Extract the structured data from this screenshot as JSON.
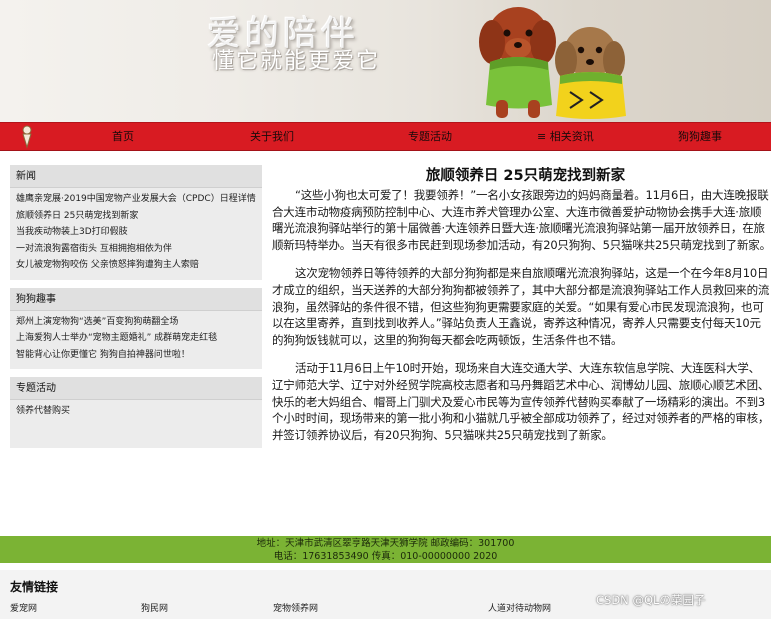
{
  "banner": {
    "title": "爱的陪伴",
    "slogan": "懂它就能更爱它"
  },
  "nav": {
    "items": [
      "首页",
      "关于我们",
      "专题活动",
      "≡ 相关资讯",
      "狗狗趣事"
    ],
    "color": "#d81b22"
  },
  "sidebar": {
    "sections": [
      {
        "title": "新闻",
        "items": [
          "雄鹰亲宠展·2019中国宠物产业发展大会（CPDC）日程详情",
          "旅顺领养日 25只萌宠找到新家",
          "当我疾动物装上3D打印假肢",
          "一对流浪狗露宿街头 互相拥抱相依为伴",
          "女儿被宠物狗咬伤 父亲愤怒摔狗遭狗主人索赔"
        ]
      },
      {
        "title": "狗狗趣事",
        "items": [
          "郑州上演宠物狗“选美”百变狗狗萌翻全场",
          "上海爱狗人士举办“宠物主题婚礼” 成群萌宠走红毯",
          "智能背心让你更懂它 狗狗自拍神器问世啦！"
        ]
      },
      {
        "title": "专题活动",
        "items": [
          "领养代替购买"
        ]
      }
    ]
  },
  "article": {
    "title": "旅顺领养日 25只萌宠找到新家",
    "paragraphs": [
      "“这些小狗也太可爱了！我要领养！”一名小女孩跟旁边的妈妈商量着。11月6日，由大连晚报联合大连市动物疫病预防控制中心、大连市养犬管理办公室、大连市微善爱护动物协会携手大连·旅顺曙光流浪狗驿站举行的第十届微善·大连领养日暨大连·旅顺曙光流浪狗驿站第一届开放领养日，在旅顺新玛特举办。当天有很多市民赶到现场参加活动，有20只狗狗、5只猫咪共25只萌宠找到了新家。",
      "这次宠物领养日等待领养的大部分狗狗都是来自旅顺曙光流浪狗驿站，这是一个在今年8月10日才成立的组织，当天送养的大部分狗狗都被领养了，其中大部分都是流浪狗驿站工作人员救回来的流浪狗，虽然驿站的条件很不错，但这些狗狗更需要家庭的关爱。“如果有爱心市民发现流浪狗，也可以在这里寄养，直到找到收养人。”驿站负责人王鑫说，寄养这种情况，寄养人只需要支付每天10元的狗狗饭钱就可以，这里的狗狗每天都会吃两顿饭，生活条件也不错。",
      "活动于11月6日上午10时开始，现场来自大连交通大学、大连东软信息学院、大连医科大学、辽宁师范大学、辽宁对外经贸学院高校志愿者和马丹舞蹈艺术中心、润博幼儿园、旅顺心顺艺术团、快乐的老大妈组合、帽哥上门驯犬及爱心市民等为宣传领养代替购买奉献了一场精彩的演出。不到3个小时时间，现场带来的第一批小狗和小猫就几乎被全部成功领养了，经过对领养者的严格的审核，并签订领养协议后，有20只狗狗、5只猫咪共25只萌宠找到了新家。"
    ]
  },
  "footer": {
    "line1": "地址：天津市武清区翠亨路天津天狮学院   邮政编码：301700",
    "line2": "电话：17631853490   传真：010-00000000 2020",
    "color": "#7bb334"
  },
  "links": {
    "title": "友情链接",
    "items": [
      "爱宠网",
      "狗民网",
      "宠物领养网",
      "人道对待动物网"
    ]
  },
  "watermark": "CSDN @QLの菜园子"
}
